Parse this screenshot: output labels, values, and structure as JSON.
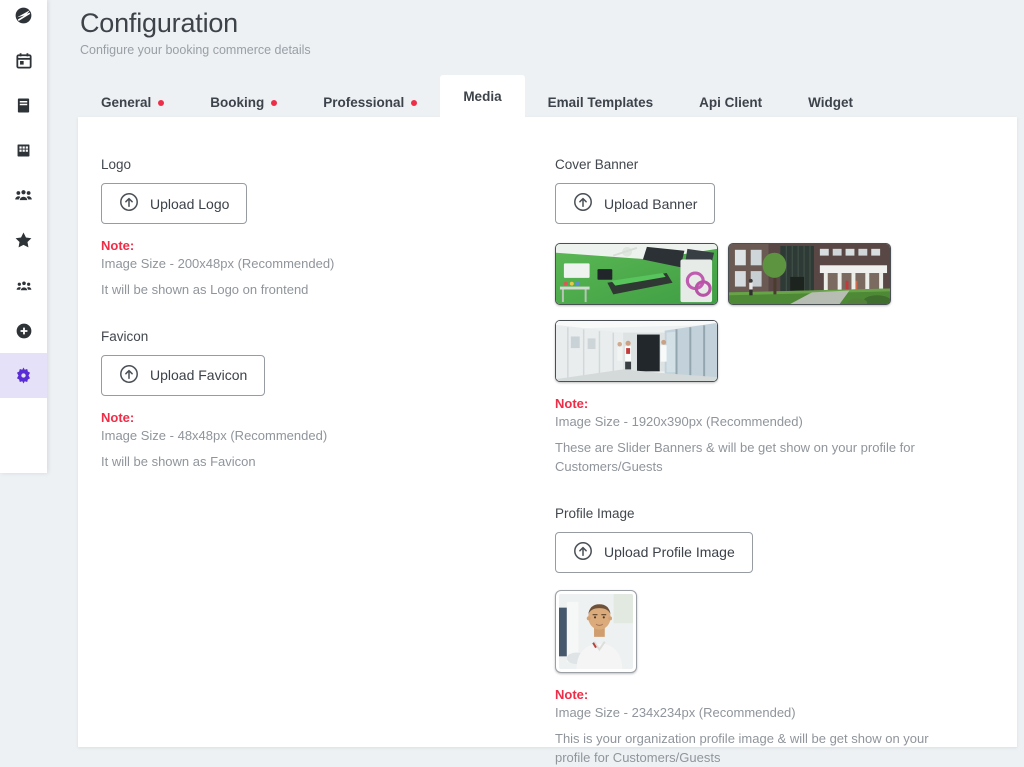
{
  "page": {
    "title": "Configuration",
    "subtitle": "Configure your booking commerce details"
  },
  "sidebar": {
    "icons": [
      {
        "name": "dashboard-logo-icon",
        "active": false
      },
      {
        "name": "calendar-icon",
        "active": false
      },
      {
        "name": "bookings-icon",
        "active": false
      },
      {
        "name": "organization-icon",
        "active": false
      },
      {
        "name": "team-icon",
        "active": false
      },
      {
        "name": "reviews-icon",
        "active": false
      },
      {
        "name": "customers-icon",
        "active": false
      },
      {
        "name": "add-icon",
        "active": false
      },
      {
        "name": "settings-icon",
        "active": true
      }
    ]
  },
  "tabs": [
    {
      "label": "General",
      "dot": true,
      "active": false
    },
    {
      "label": "Booking",
      "dot": true,
      "active": false
    },
    {
      "label": "Professional",
      "dot": true,
      "active": false
    },
    {
      "label": "Media",
      "dot": false,
      "active": true
    },
    {
      "label": "Email Templates",
      "dot": false,
      "active": false
    },
    {
      "label": "Api Client",
      "dot": false,
      "active": false
    },
    {
      "label": "Widget",
      "dot": false,
      "active": false
    }
  ],
  "media": {
    "logo": {
      "label": "Logo",
      "button": "Upload Logo",
      "note_label": "Note:",
      "size": "Image Size - 200x48px (Recommended)",
      "description": "It will be shown as Logo on frontend"
    },
    "favicon": {
      "label": "Favicon",
      "button": "Upload Favicon",
      "note_label": "Note:",
      "size": "Image Size - 48x48px (Recommended)",
      "description": "It will be shown as Favicon"
    },
    "cover_banner": {
      "label": "Cover Banner",
      "button": "Upload Banner",
      "note_label": "Note:",
      "size": "Image Size - 1920x390px (Recommended)",
      "description": "These are Slider Banners & will be get show on your profile for Customers/Guests",
      "thumbnails": [
        "operating-room-photo",
        "clinic-building-photo",
        "hospital-hallway-photo"
      ]
    },
    "profile_image": {
      "label": "Profile Image",
      "button": "Upload Profile Image",
      "note_label": "Note:",
      "size": "Image Size - 234x234px (Recommended)",
      "description": "This is your organization profile image & will be get show on your profile for Customers/Guests",
      "thumbnails": [
        "profile-photo"
      ]
    }
  },
  "colors": {
    "accent": "#5a2dd4",
    "accent_bg": "#e5e1f8",
    "note_red": "#ee2e48",
    "tab_dot_red": "#ee2e48",
    "text_dark": "#3c4249",
    "text_gray": "#8f959b",
    "page_bg": "#edf1f4",
    "card_bg": "#ffffff"
  }
}
